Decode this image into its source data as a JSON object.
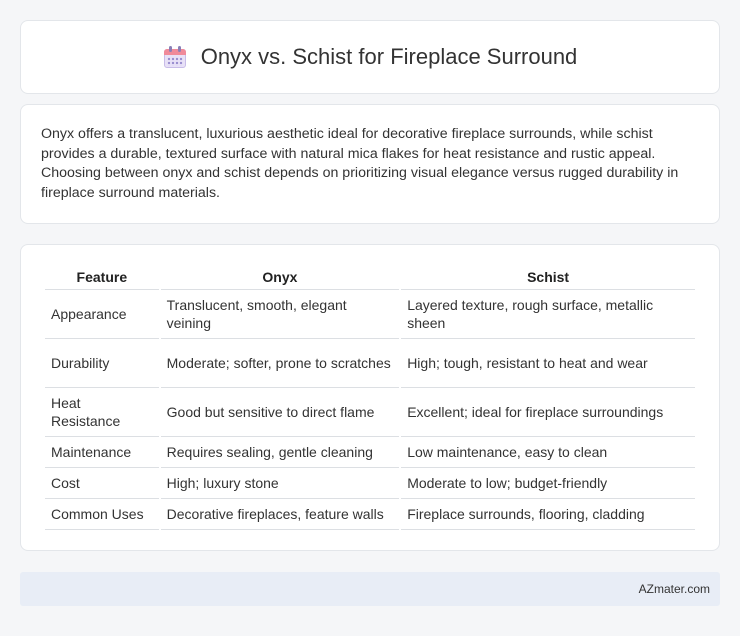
{
  "header": {
    "title": "Onyx vs. Schist for Fireplace Surround",
    "icon": "calendar-icon"
  },
  "intro": {
    "text": "Onyx offers a translucent, luxurious aesthetic ideal for decorative fireplace surrounds, while schist provides a durable, textured surface with natural mica flakes for heat resistance and rustic appeal. Choosing between onyx and schist depends on prioritizing visual elegance versus rugged durability in fireplace surround materials."
  },
  "table": {
    "headers": [
      "Feature",
      "Onyx",
      "Schist"
    ],
    "rows": [
      [
        "Appearance",
        "Translucent, smooth, elegant veining",
        "Layered texture, rough surface, metallic sheen"
      ],
      [
        "Durability",
        "Moderate; softer, prone to scratches",
        "High; tough, resistant to heat and wear"
      ],
      [
        "Heat Resistance",
        "Good but sensitive to direct flame",
        "Excellent; ideal for fireplace surroundings"
      ],
      [
        "Maintenance",
        "Requires sealing, gentle cleaning",
        "Low maintenance, easy to clean"
      ],
      [
        "Cost",
        "High; luxury stone",
        "Moderate to low; budget-friendly"
      ],
      [
        "Common Uses",
        "Decorative fireplaces, feature walls",
        "Fireplace surrounds, flooring, cladding"
      ]
    ]
  },
  "footer": {
    "brand": "AZmater.com"
  }
}
